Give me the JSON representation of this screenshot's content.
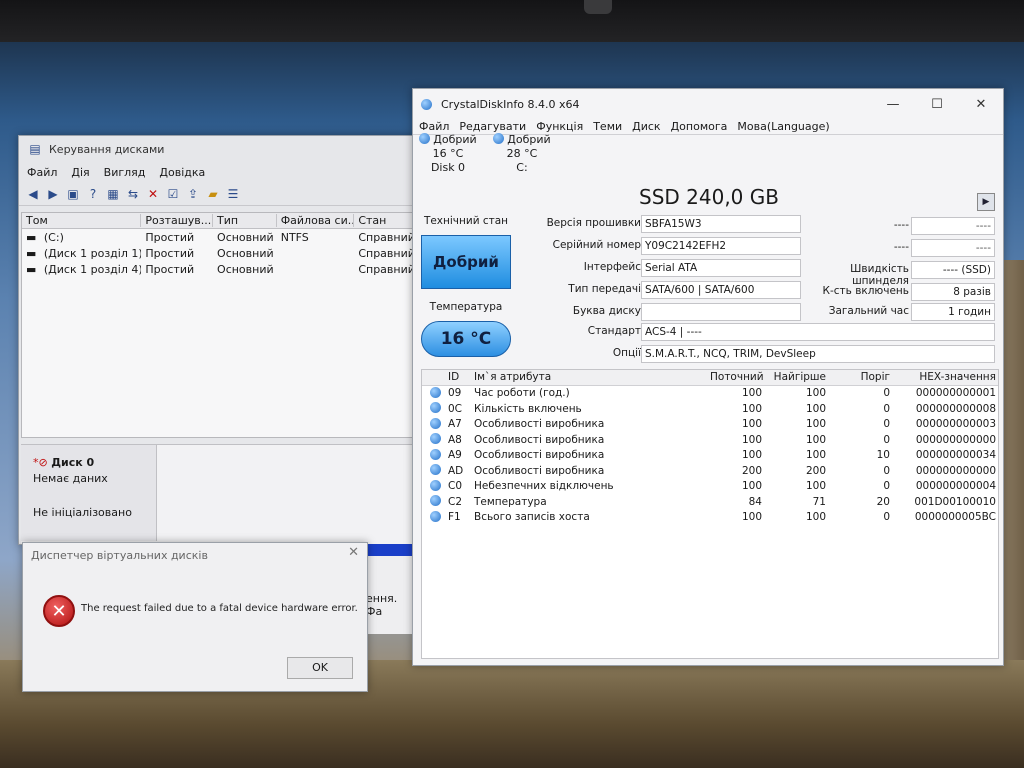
{
  "disk_mgmt": {
    "title": "Керування дисками",
    "menu": [
      "Файл",
      "Дія",
      "Вигляд",
      "Довідка"
    ],
    "columns": [
      "Том",
      "Розташув...",
      "Тип",
      "Файлова си...",
      "Стан"
    ],
    "rows": [
      [
        "(C:)",
        "Простий",
        "Основний",
        "NTFS",
        "Справний..."
      ],
      [
        "(Диск 1 розділ 1)",
        "Простий",
        "Основний",
        "",
        "Справний..."
      ],
      [
        "(Диск 1 розділ 4)",
        "Простий",
        "Основний",
        "",
        "Справний..."
      ]
    ],
    "disk0_name": "Диск 0",
    "disk0_status": "Немає даних",
    "disk0_init": "Не ініціалізовано",
    "partial_text": "ення. Фа"
  },
  "dialog": {
    "title": "Диспетчер віртуальних дисків",
    "message": "The request failed due to a fatal device hardware error.",
    "ok": "OK",
    "close": "✕"
  },
  "cdi": {
    "title": "CrystalDiskInfo 8.4.0 x64",
    "menu": [
      "Файл",
      "Редагувати",
      "Функція",
      "Теми",
      "Диск",
      "Допомога",
      "Мова(Language)"
    ],
    "disks": [
      {
        "status": "Добрий",
        "temp": "16 °C",
        "name": "Disk 0"
      },
      {
        "status": "Добрий",
        "temp": "28 °C",
        "name": "C:"
      }
    ],
    "model": "SSD 240,0 GB",
    "health_label": "Технічний стан",
    "health_value": "Добрий",
    "temp_label": "Температура",
    "temp_value": "16 °C",
    "fields": {
      "firmware_label": "Версія прошивки",
      "firmware": "SBFA15W3",
      "serial_label": "Серійний номер",
      "serial": "Y09C2142EFH2",
      "interface_label": "Інтерфейс",
      "interface": "Serial ATA",
      "transfer_label": "Тип передачі",
      "transfer": "SATA/600 | SATA/600",
      "letter_label": "Буква диску",
      "letter": "",
      "standard_label": "Стандарт",
      "standard": "ACS-4 | ----",
      "features_label": "Опції",
      "features": "S.M.A.R.T., NCQ, TRIM, DevSleep",
      "blank_a": "----",
      "blank_b": "----",
      "blank_a_val": "----",
      "blank_b_val": "----",
      "rpm_label": "Швидкість шпинделя",
      "rpm": "---- (SSD)",
      "power_count_label": "К-сть включень",
      "power_count": "8 разів",
      "power_hours_label": "Загальний час",
      "power_hours": "1 годин"
    },
    "attr_columns": [
      "ID",
      "Ім`я атрибута",
      "Поточний",
      "Найгірше",
      "Поріг",
      "HEX-значення"
    ],
    "attributes": [
      [
        "09",
        "Час роботи (год.)",
        "100",
        "100",
        "0",
        "000000000001"
      ],
      [
        "0C",
        "Кількість включень",
        "100",
        "100",
        "0",
        "000000000008"
      ],
      [
        "A7",
        "Особливості виробника",
        "100",
        "100",
        "0",
        "000000000003"
      ],
      [
        "A8",
        "Особливості виробника",
        "100",
        "100",
        "0",
        "000000000000"
      ],
      [
        "A9",
        "Особливості виробника",
        "100",
        "100",
        "10",
        "000000000034"
      ],
      [
        "AD",
        "Особливості виробника",
        "200",
        "200",
        "0",
        "000000000000"
      ],
      [
        "C0",
        "Небезпечних відключень",
        "100",
        "100",
        "0",
        "000000000004"
      ],
      [
        "C2",
        "Температура",
        "84",
        "71",
        "20",
        "001D00100010"
      ],
      [
        "F1",
        "Всього записів хоста",
        "100",
        "100",
        "0",
        "0000000005BC"
      ]
    ]
  }
}
